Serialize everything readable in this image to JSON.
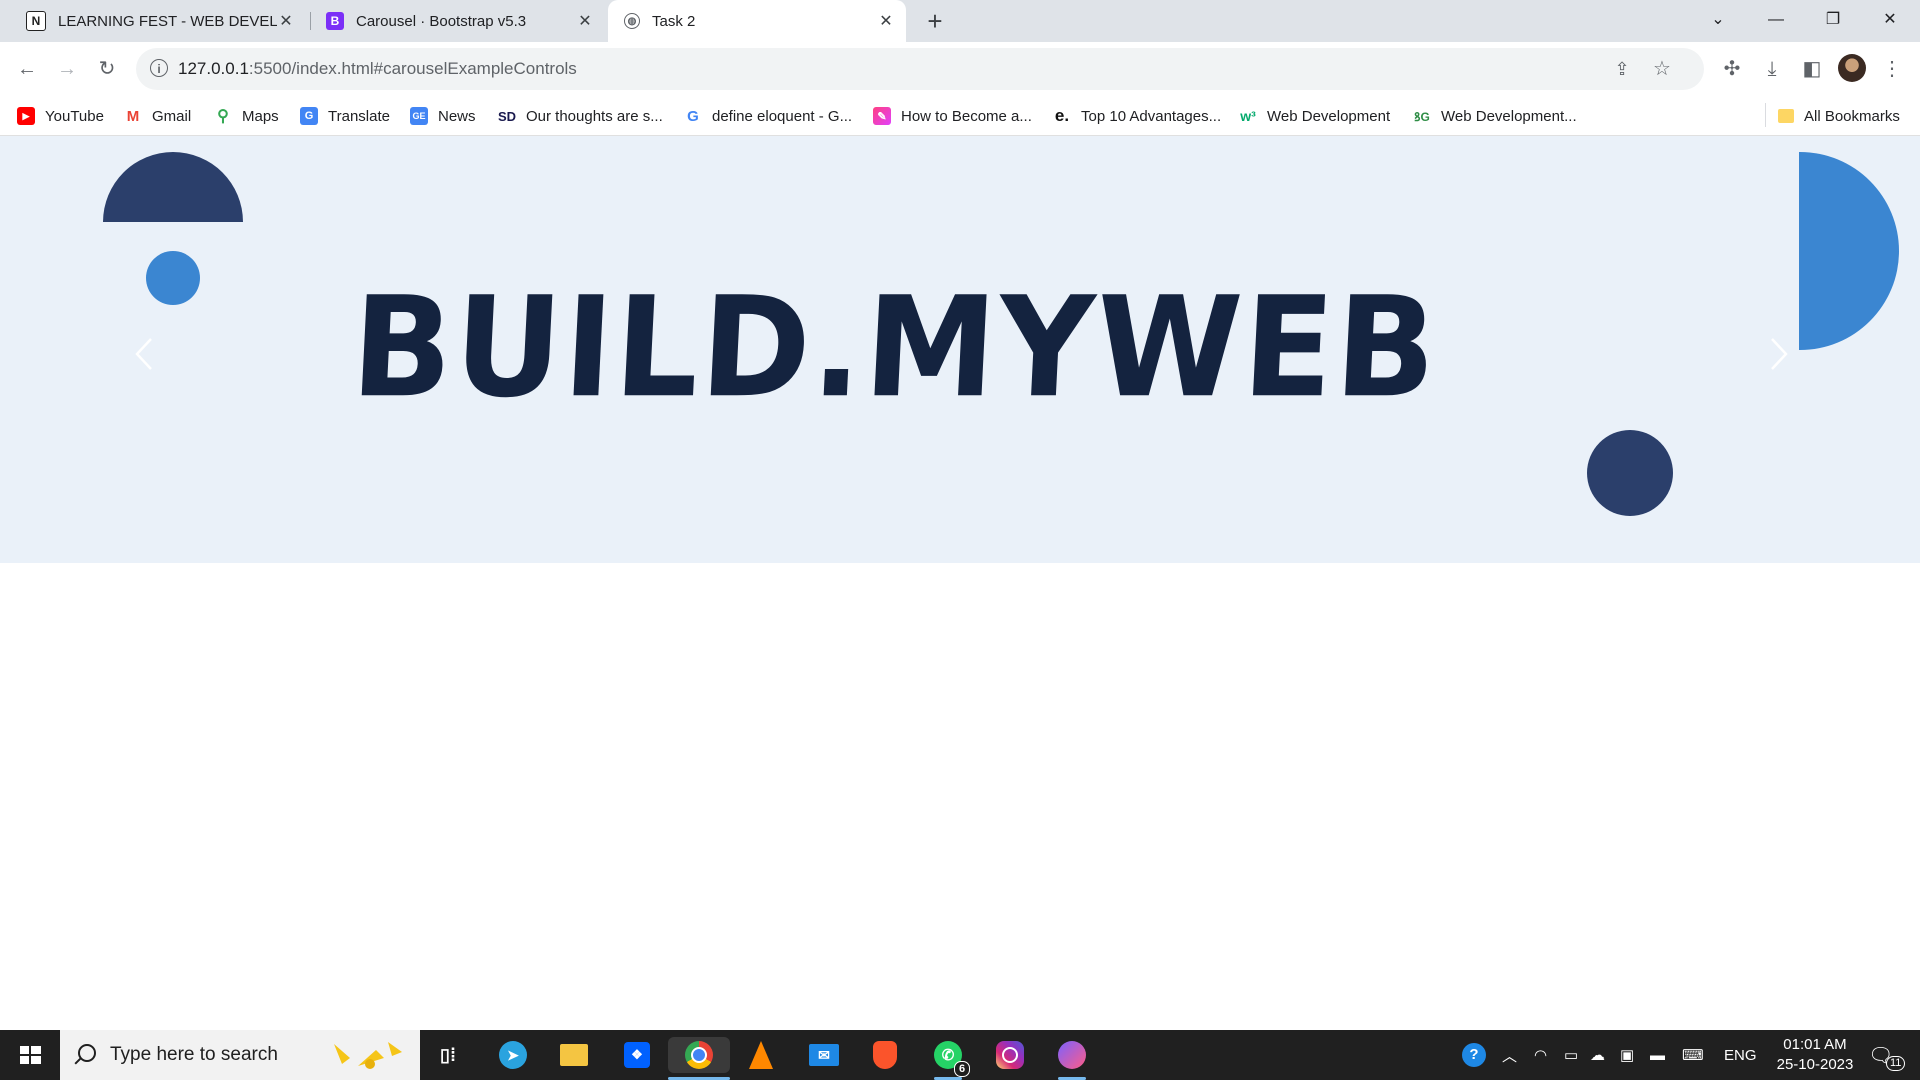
{
  "browser": {
    "tabs": [
      {
        "title": "LEARNING FEST - WEB DEVELOP",
        "icon": "notion-icon"
      },
      {
        "title": "Carousel · Bootstrap v5.3",
        "icon": "bootstrap-icon"
      },
      {
        "title": "Task 2",
        "icon": "globe-icon"
      }
    ],
    "active_tab": "Task 2",
    "url_host": "127.0.0.1",
    "url_path": ":5500/index.html#carouselExampleControls"
  },
  "bookmarks": [
    {
      "label": "YouTube",
      "icon": "youtube-icon",
      "color": "#ff0000"
    },
    {
      "label": "Gmail",
      "icon": "gmail-icon",
      "color": "#ea4335"
    },
    {
      "label": "Maps",
      "icon": "maps-icon",
      "color": "#34a853"
    },
    {
      "label": "Translate",
      "icon": "translate-icon",
      "color": "#4285f4"
    },
    {
      "label": "News",
      "icon": "news-icon",
      "color": "#4285f4"
    },
    {
      "label": "Our thoughts are s...",
      "icon": "sd-icon",
      "color": "#1a1a4e"
    },
    {
      "label": "define eloquent - G...",
      "icon": "google-icon",
      "color": "#4285f4"
    },
    {
      "label": "How to Become a...",
      "icon": "bookmark-site-icon",
      "color": "#e040fb"
    },
    {
      "label": "Top 10 Advantages...",
      "icon": "e-icon",
      "color": "#111111"
    },
    {
      "label": "Web Development",
      "icon": "w3-icon",
      "color": "#04aa6d"
    },
    {
      "label": "Web Development...",
      "icon": "gfg-icon",
      "color": "#2f8d46"
    }
  ],
  "all_bookmarks": "All Bookmarks",
  "page": {
    "brand": "BUILD.MYWEB",
    "colors": {
      "background": "#eaf1f9",
      "navy": "#2b3f6b",
      "blue": "#3b86d1",
      "text": "#14233f"
    }
  },
  "taskbar": {
    "search_placeholder": "Type here to search",
    "whatsapp_badge": "6",
    "tray_language": "ENG",
    "time": "01:01 AM",
    "date": "25-10-2023",
    "notifications_badge": "11"
  }
}
